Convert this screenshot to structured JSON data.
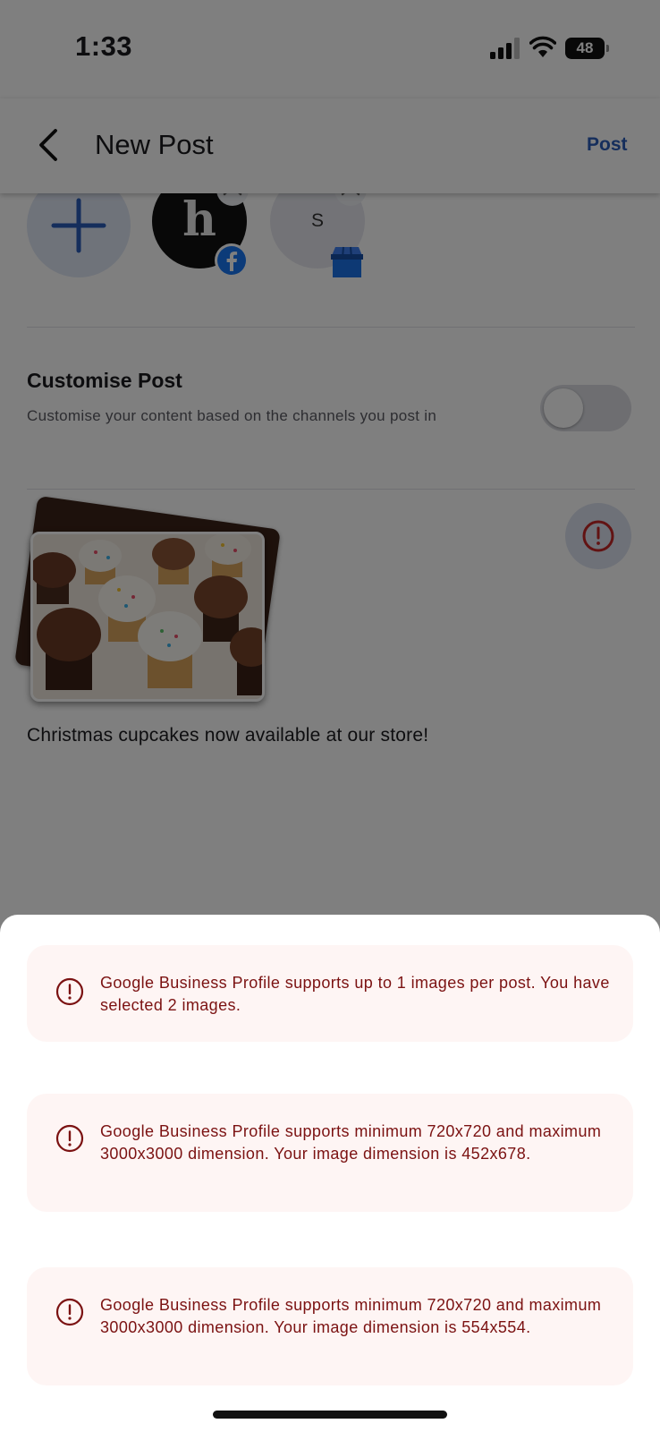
{
  "status_bar": {
    "time": "1:33",
    "battery": "48"
  },
  "header": {
    "title": "New Post",
    "post_label": "Post",
    "back_icon": "chevron-left-icon"
  },
  "channels": {
    "add_icon": "plus-icon",
    "items": [
      {
        "initial": "h",
        "network": "facebook"
      },
      {
        "initial": "S",
        "network": "google-business-profile"
      }
    ]
  },
  "customise": {
    "title": "Customise Post",
    "description": "Customise your content based on the channels you post in",
    "enabled": false
  },
  "media": {
    "image_count": 2,
    "warning_icon": "alert-circle-icon"
  },
  "caption": "Christmas cupcakes now available at our store!",
  "errors": [
    {
      "message": "Google Business Profile supports up to 1 images per post. You have selected 2 images."
    },
    {
      "message": "Google Business Profile supports minimum 720x720 and maximum 3000x3000 dimension. Your image dimension is 452x678."
    },
    {
      "message": "Google Business Profile supports minimum 720x720 and maximum 3000x3000 dimension. Your image dimension is 554x554."
    }
  ],
  "colors": {
    "accent": "#2a5cb8",
    "error_text": "#7b1212",
    "error_bg": "#fef5f4",
    "warning_icon": "#c42727"
  }
}
